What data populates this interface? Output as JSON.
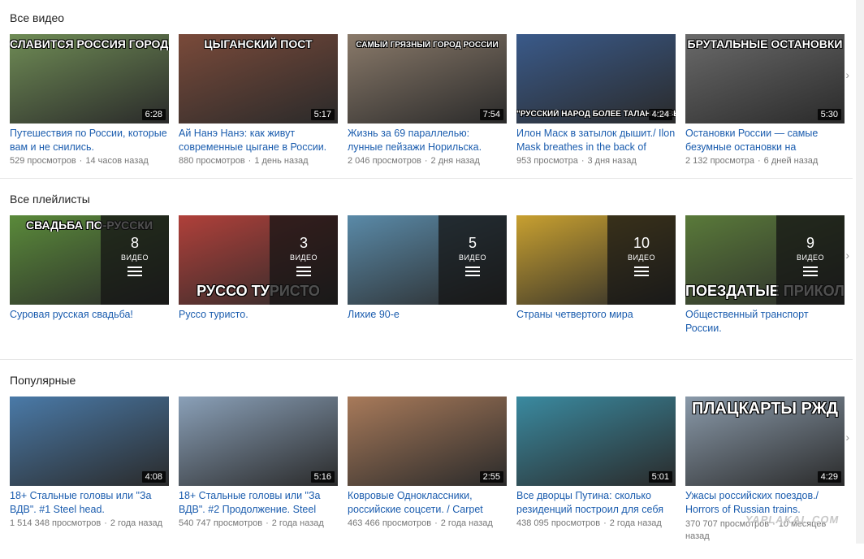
{
  "sections": [
    {
      "title": "Все видео",
      "items": [
        {
          "caption": "СЛАВИТСЯ РОССИЯ ГОРОДАМИ СВОИМИ",
          "duration": "6:28",
          "title": "Путешествия по России, которые вам и не снились.",
          "views": "529 просмотров",
          "age": "14 часов назад",
          "bg": "#6f8c55"
        },
        {
          "caption": "ЦЫГАНСКИЙ ПОСТ",
          "duration": "5:17",
          "title": "Ай Нанэ Нанэ: как живут современные цыгане в России.",
          "views": "880 просмотров",
          "age": "1 день назад",
          "bg": "#7a4a3a"
        },
        {
          "caption": "САМЫЙ ГРЯЗНЫЙ ГОРОД РОССИИ",
          "duration": "7:54",
          "title": "Жизнь за 69 параллелью: лунные пейзажи Норильска.",
          "views": "2 046 просмотров",
          "age": "2 дня назад",
          "bg": "#8a7a6a"
        },
        {
          "caption": "\"РУССКИЙ НАРОД БОЛЕЕ ТАЛАНТЛИВЫЙ, ЧЕМ АМЕРИКАН",
          "duration": "4:24",
          "title": "Илон Маск в затылок дышит./ Ilon Mask breathes in the back of",
          "views": "953 просмотра",
          "age": "3 дня назад",
          "bg": "#3a5a8a"
        },
        {
          "caption": "БРУТАЛЬНЫЕ ОСТАНОВКИ",
          "duration": "5:30",
          "title": "Остановки России — самые безумные остановки на",
          "views": "2 132 просмотра",
          "age": "6 дней назад",
          "bg": "#6a6a6a"
        }
      ]
    },
    {
      "title": "Все плейлисты",
      "items": [
        {
          "caption": "СВАДЬБА ПО-РУССКИ",
          "count": "8",
          "count_label": "ВИДЕО",
          "title": "Суровая русская свадьба!",
          "bg": "#5a8a3a"
        },
        {
          "caption": "РУССО ТУРИСТО",
          "count": "3",
          "count_label": "ВИДЕО",
          "title": "Руссо туристо.",
          "bg": "#b0403a"
        },
        {
          "caption": "",
          "count": "5",
          "count_label": "ВИДЕО",
          "title": "Лихие 90-е",
          "bg": "#5a8aa8"
        },
        {
          "caption": "",
          "count": "10",
          "count_label": "ВИДЕО",
          "title": "Страны четвертого мира",
          "bg": "#c8a030"
        },
        {
          "caption": "ПОЕЗДАТЫЕ ПРИКОЛЫ",
          "count": "9",
          "count_label": "ВИДЕО",
          "title": "Общественный транспорт России.",
          "bg": "#5a7a3a"
        }
      ]
    },
    {
      "title": "Популярные",
      "items": [
        {
          "caption": "",
          "duration": "4:08",
          "title": "18+ Стальные головы или \"За ВДВ\". #1 Steel head.",
          "views": "1 514 348 просмотров",
          "age": "2 года назад",
          "bg": "#4a7aa8"
        },
        {
          "caption": "",
          "duration": "5:16",
          "title": "18+ Стальные головы или \"За ВДВ\". #2 Продолжение. Steel",
          "views": "540 747 просмотров",
          "age": "2 года назад",
          "bg": "#8aa0b8"
        },
        {
          "caption": "",
          "duration": "2:55",
          "title": "Ковровые Одноклассники, российские соцсети. / Carpet",
          "views": "463 466 просмотров",
          "age": "2 года назад",
          "bg": "#a87a5a"
        },
        {
          "caption": "",
          "duration": "5:01",
          "title": "Все дворцы Путина: сколько резиденций построил для себя",
          "views": "438 095 просмотров",
          "age": "2 года назад",
          "bg": "#3a8aa0"
        },
        {
          "caption": "ПЛАЦКАРТЫ РЖД",
          "duration": "4:29",
          "title": "Ужасы российских поездов./ Horrors of Russian trains.",
          "views": "370 707 просмотров",
          "age": "10 месяцев назад",
          "bg": "#8a9aaa"
        }
      ]
    }
  ],
  "watermark": "YAPLAKAL.COM",
  "next_icon": "›"
}
